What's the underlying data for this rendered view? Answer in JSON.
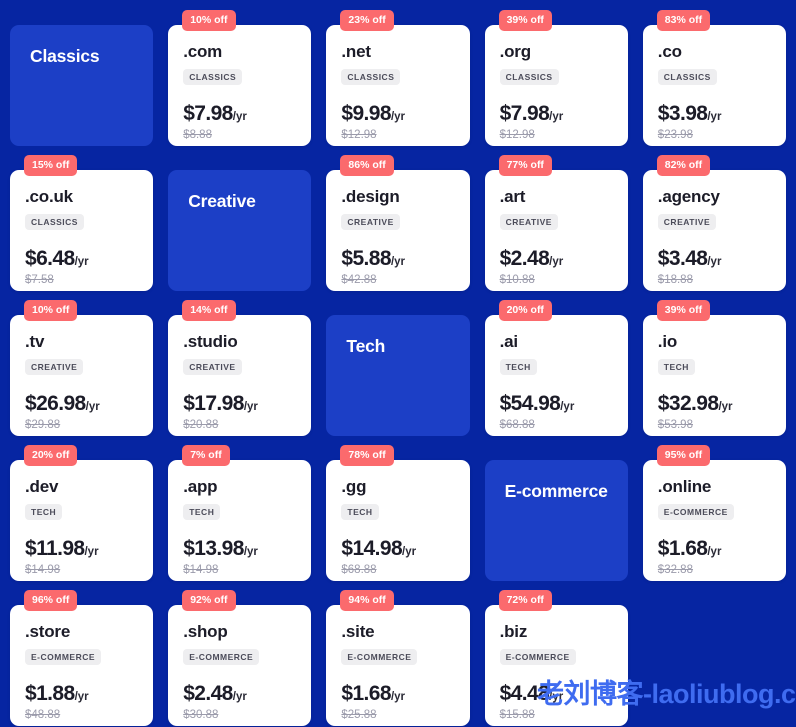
{
  "page": {
    "background_color": "#0625a2",
    "category_tile_color": "#1c3fc6",
    "badge_color": "#fb6a6d",
    "card_color": "#ffffff",
    "watermark": "老刘博客-laoliublog.cn",
    "watermark_color": "#3f6cf0"
  },
  "cells": [
    {
      "kind": "category",
      "title": "Classics"
    },
    {
      "kind": "domain",
      "badge": "10% off",
      "tld": ".com",
      "tag": "CLASSICS",
      "price": "$7.98",
      "per": "/yr",
      "old_price": "$8.88"
    },
    {
      "kind": "domain",
      "badge": "23% off",
      "tld": ".net",
      "tag": "CLASSICS",
      "price": "$9.98",
      "per": "/yr",
      "old_price": "$12.98"
    },
    {
      "kind": "domain",
      "badge": "39% off",
      "tld": ".org",
      "tag": "CLASSICS",
      "price": "$7.98",
      "per": "/yr",
      "old_price": "$12.98"
    },
    {
      "kind": "domain",
      "badge": "83% off",
      "tld": ".co",
      "tag": "CLASSICS",
      "price": "$3.98",
      "per": "/yr",
      "old_price": "$23.98"
    },
    {
      "kind": "domain",
      "badge": "15% off",
      "tld": ".co.uk",
      "tag": "CLASSICS",
      "price": "$6.48",
      "per": "/yr",
      "old_price": "$7.58"
    },
    {
      "kind": "category",
      "title": "Creative"
    },
    {
      "kind": "domain",
      "badge": "86% off",
      "tld": ".design",
      "tag": "CREATIVE",
      "price": "$5.88",
      "per": "/yr",
      "old_price": "$42.88"
    },
    {
      "kind": "domain",
      "badge": "77% off",
      "tld": ".art",
      "tag": "CREATIVE",
      "price": "$2.48",
      "per": "/yr",
      "old_price": "$10.88"
    },
    {
      "kind": "domain",
      "badge": "82% off",
      "tld": ".agency",
      "tag": "CREATIVE",
      "price": "$3.48",
      "per": "/yr",
      "old_price": "$18.88"
    },
    {
      "kind": "domain",
      "badge": "10% off",
      "tld": ".tv",
      "tag": "CREATIVE",
      "price": "$26.98",
      "per": "/yr",
      "old_price": "$29.88"
    },
    {
      "kind": "domain",
      "badge": "14% off",
      "tld": ".studio",
      "tag": "CREATIVE",
      "price": "$17.98",
      "per": "/yr",
      "old_price": "$20.88"
    },
    {
      "kind": "category",
      "title": "Tech"
    },
    {
      "kind": "domain",
      "badge": "20% off",
      "tld": ".ai",
      "tag": "TECH",
      "price": "$54.98",
      "per": "/yr",
      "old_price": "$68.88"
    },
    {
      "kind": "domain",
      "badge": "39% off",
      "tld": ".io",
      "tag": "TECH",
      "price": "$32.98",
      "per": "/yr",
      "old_price": "$53.98"
    },
    {
      "kind": "domain",
      "badge": "20% off",
      "tld": ".dev",
      "tag": "TECH",
      "price": "$11.98",
      "per": "/yr",
      "old_price": "$14.98"
    },
    {
      "kind": "domain",
      "badge": "7% off",
      "tld": ".app",
      "tag": "TECH",
      "price": "$13.98",
      "per": "/yr",
      "old_price": "$14.98"
    },
    {
      "kind": "domain",
      "badge": "78% off",
      "tld": ".gg",
      "tag": "TECH",
      "price": "$14.98",
      "per": "/yr",
      "old_price": "$68.88"
    },
    {
      "kind": "category",
      "title": "E-commerce"
    },
    {
      "kind": "domain",
      "badge": "95% off",
      "tld": ".online",
      "tag": "E-COMMERCE",
      "price": "$1.68",
      "per": "/yr",
      "old_price": "$32.88"
    },
    {
      "kind": "domain",
      "badge": "96% off",
      "tld": ".store",
      "tag": "E-COMMERCE",
      "price": "$1.88",
      "per": "/yr",
      "old_price": "$48.88"
    },
    {
      "kind": "domain",
      "badge": "92% off",
      "tld": ".shop",
      "tag": "E-COMMERCE",
      "price": "$2.48",
      "per": "/yr",
      "old_price": "$30.88"
    },
    {
      "kind": "domain",
      "badge": "94% off",
      "tld": ".site",
      "tag": "E-COMMERCE",
      "price": "$1.68",
      "per": "/yr",
      "old_price": "$25.88"
    },
    {
      "kind": "domain",
      "badge": "72% off",
      "tld": ".biz",
      "tag": "E-COMMERCE",
      "price": "$4.48",
      "per": "/yr",
      "old_price": "$15.88"
    },
    {
      "kind": "empty"
    }
  ]
}
